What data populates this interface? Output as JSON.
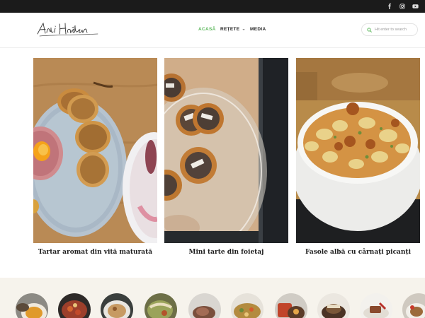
{
  "topbar": {
    "social": [
      {
        "name": "facebook-icon"
      },
      {
        "name": "instagram-icon"
      },
      {
        "name": "youtube-icon"
      }
    ]
  },
  "header": {
    "logo_text": "Adi Hădean",
    "nav": [
      {
        "label": "Acasă",
        "active": true
      },
      {
        "label": "Rețete",
        "has_dropdown": true
      },
      {
        "label": "Media"
      }
    ],
    "search": {
      "placeholder": "Hit enter to search"
    }
  },
  "colors": {
    "accent": "#5cb85c",
    "topbar": "#1b1b1b",
    "strip_bg": "#f6f3ec"
  },
  "cards": [
    {
      "title": "Tartar aromat din vită maturată"
    },
    {
      "title": "Mini tarte din foietaj"
    },
    {
      "title": "Fasole albă cu cârnați picanți"
    }
  ],
  "categories_count_visible": 10
}
